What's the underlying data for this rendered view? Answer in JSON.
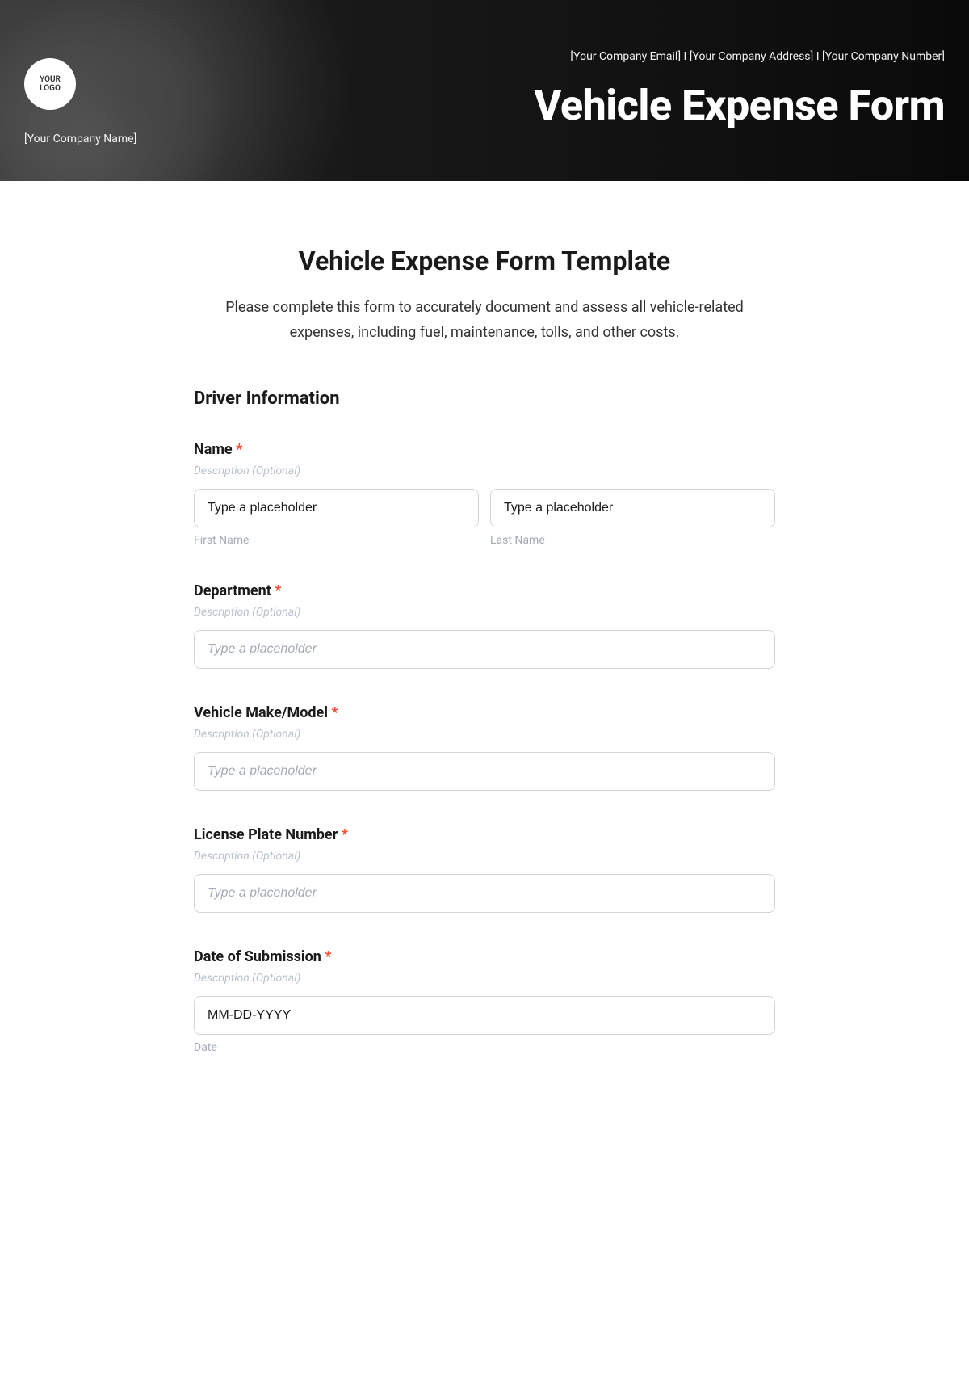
{
  "header": {
    "logo_text": "YOUR\nLOGO",
    "company_name": "[Your Company Name]",
    "info_email": "[Your Company Email]",
    "info_sep": " I ",
    "info_address": "[Your Company Address]",
    "info_number": "[Your Company Number]",
    "title": "Vehicle Expense Form"
  },
  "form": {
    "title": "Vehicle Expense Form Template",
    "description": "Please complete this form to accurately document and assess all vehicle-related expenses, including fuel, maintenance, tolls, and other costs.",
    "section1_title": "Driver Information",
    "required_mark": "*",
    "desc_optional": "Description (Optional)",
    "placeholder_text": "Type a placeholder",
    "name": {
      "label": "Name",
      "first_value": "Type a placeholder",
      "last_value": "Type a placeholder",
      "first_sublabel": "First Name",
      "last_sublabel": "Last Name"
    },
    "department": {
      "label": "Department"
    },
    "vehicle": {
      "label": "Vehicle Make/Model"
    },
    "plate": {
      "label": "License Plate Number"
    },
    "date": {
      "label": "Date of Submission",
      "value": "MM-DD-YYYY",
      "sublabel": "Date"
    }
  }
}
